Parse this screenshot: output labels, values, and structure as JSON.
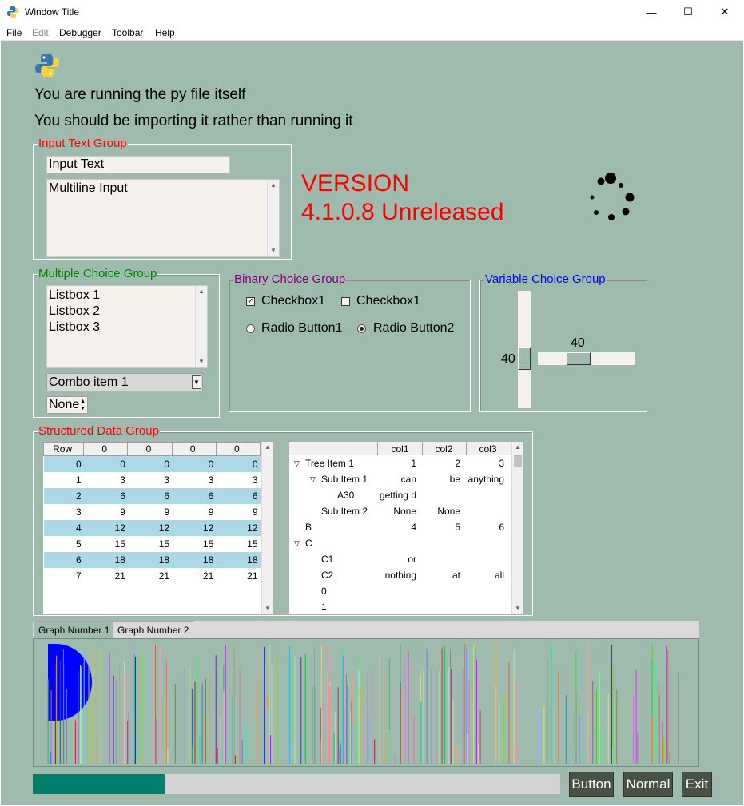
{
  "window": {
    "title": "Window Title",
    "minimize_glyph": "—",
    "maximize_glyph": "☐",
    "close_glyph": "✕"
  },
  "menu": [
    "File",
    "Edit",
    "Debugger",
    "Toolbar",
    "Help"
  ],
  "header": {
    "line1": "You are running the py file itself",
    "line2": "You should be importing it rather than running it"
  },
  "input_group": {
    "title": "Input Text Group",
    "input_value": "Input Text",
    "multiline_value": "Multiline Input"
  },
  "version": {
    "line1": "VERSION",
    "line2": "4.1.0.8 Unreleased"
  },
  "multiple_choice": {
    "title": "Multiple Choice Group",
    "listbox": [
      "Listbox 1",
      "Listbox 2",
      "Listbox 3"
    ],
    "combo_value": "Combo item 1",
    "spin_value": "None"
  },
  "binary_choice": {
    "title": "Binary Choice Group",
    "checkbox1": {
      "label": "Checkbox1",
      "checked": true
    },
    "checkbox2": {
      "label": "Checkbox1",
      "checked": false
    },
    "radio1": {
      "label": "Radio Button1",
      "selected": false
    },
    "radio2": {
      "label": "Radio Button2",
      "selected": true
    }
  },
  "variable_choice": {
    "title": "Variable Choice Group",
    "vertical_slider": {
      "value": "40",
      "level": 0.4
    },
    "horizontal_slider": {
      "value": "40",
      "level": 0.4
    }
  },
  "structured": {
    "title": "Structured Data Group",
    "table_headers": [
      "Row",
      "0",
      "0",
      "0",
      "0"
    ],
    "table_rows": [
      [
        "0",
        "0",
        "0",
        "0",
        "0"
      ],
      [
        "1",
        "3",
        "3",
        "3",
        "3"
      ],
      [
        "2",
        "6",
        "6",
        "6",
        "6"
      ],
      [
        "3",
        "9",
        "9",
        "9",
        "9"
      ],
      [
        "4",
        "12",
        "12",
        "12",
        "12"
      ],
      [
        "5",
        "15",
        "15",
        "15",
        "15"
      ],
      [
        "6",
        "18",
        "18",
        "18",
        "18"
      ],
      [
        "7",
        "21",
        "21",
        "21",
        "21"
      ]
    ],
    "tree_headers": [
      "",
      "col1",
      "col2",
      "col3"
    ],
    "tree_rows": [
      {
        "name": "Tree Item 1",
        "level": 0,
        "expander": "open",
        "col1": "1",
        "col2": "2",
        "col3": "3"
      },
      {
        "name": "Sub Item 1",
        "level": 1,
        "expander": "open",
        "col1": "can",
        "col2": "be",
        "col3": "anything"
      },
      {
        "name": "A30",
        "level": 2,
        "expander": "",
        "col1": "getting d",
        "col2": "",
        "col3": ""
      },
      {
        "name": "Sub Item 2",
        "level": 1,
        "expander": "",
        "col1": "None",
        "col2": "None",
        "col3": ""
      },
      {
        "name": "B",
        "level": 0,
        "expander": "",
        "col1": "4",
        "col2": "5",
        "col3": "6"
      },
      {
        "name": "C",
        "level": 0,
        "expander": "open",
        "col1": "",
        "col2": "",
        "col3": ""
      },
      {
        "name": "C1",
        "level": 1,
        "expander": "",
        "col1": "or",
        "col2": "",
        "col3": ""
      },
      {
        "name": "C2",
        "level": 1,
        "expander": "",
        "col1": "nothing",
        "col2": "at",
        "col3": "all"
      },
      {
        "name": "0",
        "level": 1,
        "expander": "",
        "col1": "",
        "col2": "",
        "col3": ""
      },
      {
        "name": "1",
        "level": 1,
        "expander": "",
        "col1": "",
        "col2": "",
        "col3": ""
      }
    ]
  },
  "tabs": [
    {
      "label": "Graph Number 1",
      "active": true
    },
    {
      "label": "Graph Number 2",
      "active": false
    }
  ],
  "graph": {
    "circle_color": "#0000ff",
    "line_count": 220
  },
  "progress": {
    "level": 0.25,
    "fill_color": "#00806c"
  },
  "buttons": {
    "button": "Button",
    "normal": "Normal",
    "exit": "Exit"
  },
  "colors": {
    "background": "#9fbbae",
    "red_text": "#ff0000",
    "green_text": "#008000",
    "purple_text": "#800080",
    "blue_text": "#0000ff"
  }
}
